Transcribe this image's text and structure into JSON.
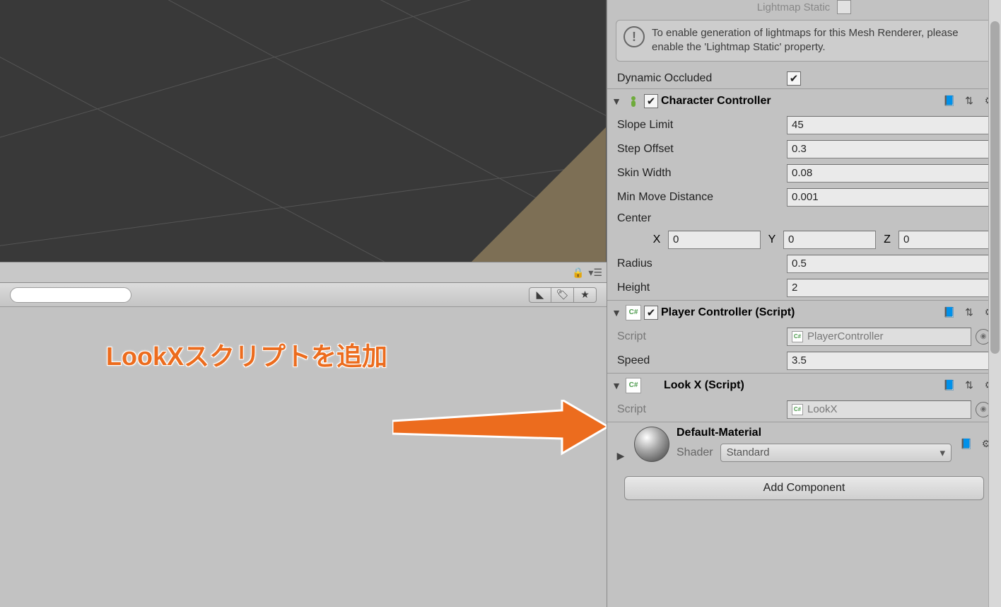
{
  "annotation": "LookXスクリプトを追加",
  "inspector": {
    "lightmap_static_label": "Lightmap Static",
    "info_text": "To enable generation of lightmaps for this Mesh Renderer, please enable the 'Lightmap Static' property.",
    "dynamic_occluded_label": "Dynamic Occluded"
  },
  "character_controller": {
    "title": "Character Controller",
    "slope_limit_label": "Slope Limit",
    "slope_limit_value": "45",
    "step_offset_label": "Step Offset",
    "step_offset_value": "0.3",
    "skin_width_label": "Skin Width",
    "skin_width_value": "0.08",
    "min_move_label": "Min Move Distance",
    "min_move_value": "0.001",
    "center_label": "Center",
    "x_label": "X",
    "x_value": "0",
    "y_label": "Y",
    "y_value": "0",
    "z_label": "Z",
    "z_value": "0",
    "radius_label": "Radius",
    "radius_value": "0.5",
    "height_label": "Height",
    "height_value": "2"
  },
  "player_controller": {
    "title": "Player Controller (Script)",
    "script_label": "Script",
    "script_value": "PlayerController",
    "speed_label": "Speed",
    "speed_value": "3.5"
  },
  "lookx": {
    "title": "Look X (Script)",
    "script_label": "Script",
    "script_value": "LookX"
  },
  "material": {
    "name": "Default-Material",
    "shader_label": "Shader",
    "shader_value": "Standard"
  },
  "add_component_label": "Add Component",
  "cs_badge": "C#",
  "search": {
    "placeholder": ""
  }
}
